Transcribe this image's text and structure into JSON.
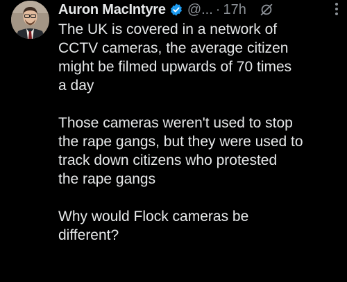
{
  "post": {
    "author_name": "Auron MacIntyre",
    "handle": "@...",
    "separator": "·",
    "time": "17h",
    "paragraphs": [
      {
        "lines": [
          "The UK is covered in a network of",
          "CCTV cameras, the average citizen",
          "might be filmed upwards of 70 times",
          "a day"
        ]
      },
      {
        "lines": [
          "Those cameras weren't used to stop",
          "the rape gangs, but they were used to",
          "track down citizens who protested",
          "the rape gangs"
        ]
      },
      {
        "lines": [
          "Why would Flock cameras be",
          "different?"
        ]
      }
    ]
  },
  "icons": {
    "avatar": "avatar",
    "verified": "verified-badge-icon",
    "grok": "grok-icon",
    "more": "more-icon"
  },
  "colors": {
    "background": "#000000",
    "text": "#e7e9ea",
    "muted": "#8b9096",
    "verified": "#1d9bf0"
  }
}
